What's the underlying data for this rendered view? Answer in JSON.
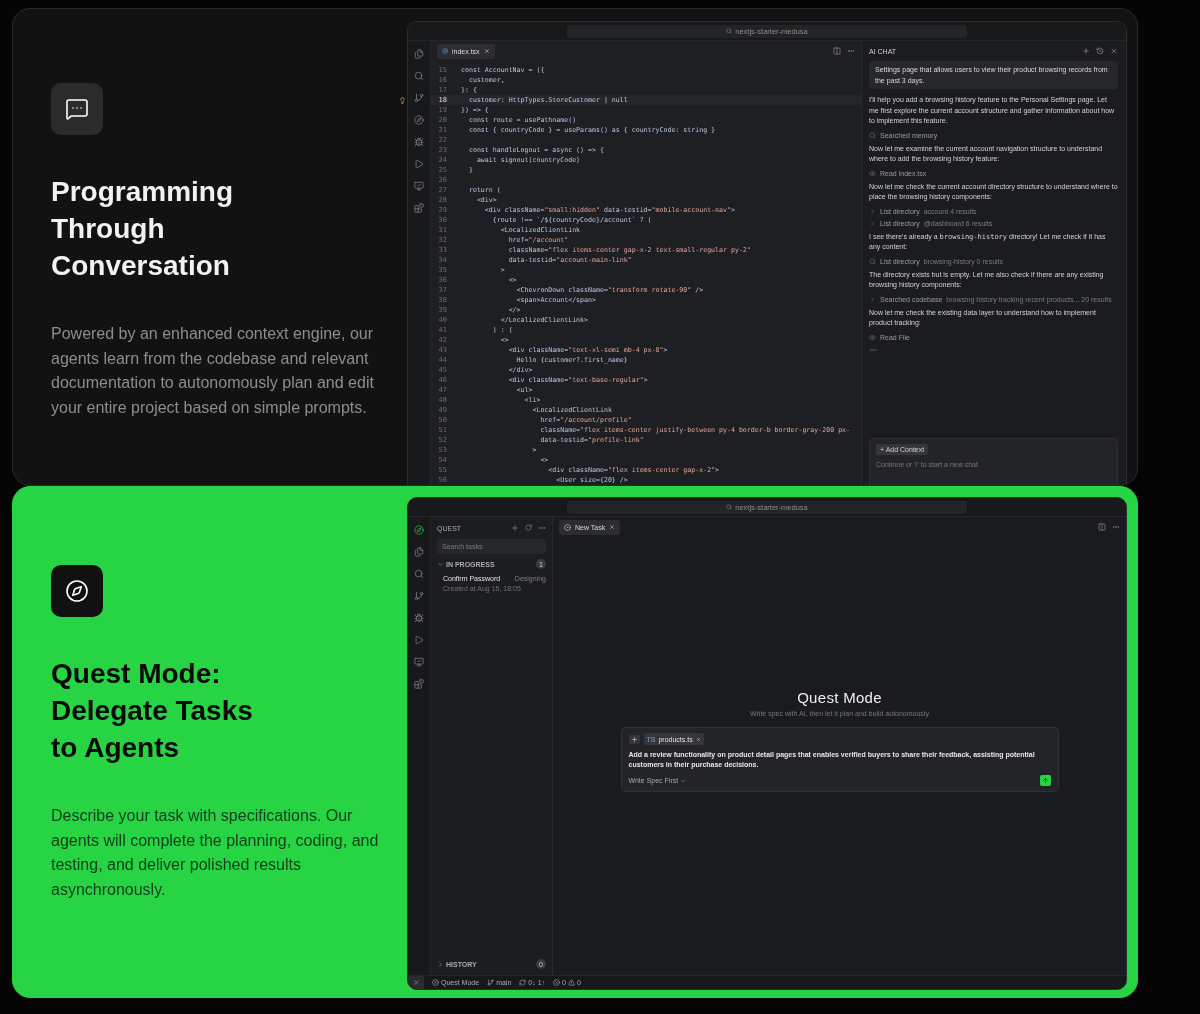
{
  "features": [
    {
      "selected": false,
      "title_lines": [
        "Programming",
        "Through",
        "Conversation"
      ],
      "description": "Powered by an enhanced context engine, our agents learn from the codebase and relevant documentation to autonomously plan and edit your entire project based on simple prompts.",
      "window": {
        "kind": "editor",
        "search": "nextjs-starter-medusa",
        "activity": [
          {
            "kind": "files",
            "selected": false
          },
          {
            "kind": "search",
            "selected": false
          },
          {
            "kind": "branch",
            "selected": false
          },
          {
            "kind": "compass",
            "selected": false
          },
          {
            "kind": "bug",
            "selected": false
          },
          {
            "kind": "play",
            "selected": false
          },
          {
            "kind": "monitor",
            "selected": false
          },
          {
            "kind": "blocks",
            "selected": false
          }
        ],
        "tabs": [
          {
            "label": "index.tsx",
            "selected": true
          }
        ],
        "lines": [
          {
            "n": "15",
            "text": "const AccountNav = ({",
            "current": false
          },
          {
            "n": "16",
            "text": "  customer,",
            "current": false
          },
          {
            "n": "17",
            "text": "}: {",
            "current": false
          },
          {
            "n": "18",
            "text": "  customer: HttpTypes.StoreCustomer | null",
            "current": true
          },
          {
            "n": "19",
            "text": "}) => {",
            "current": false
          },
          {
            "n": "20",
            "text": "  const route = usePathname()",
            "current": false
          },
          {
            "n": "21",
            "text": "  const { countryCode } = useParams() as { countryCode: string }",
            "current": false
          },
          {
            "n": "22",
            "current": false
          },
          {
            "n": "23",
            "text": "  const handleLogout = async () => {",
            "current": false
          },
          {
            "n": "24",
            "text": "    await signout(countryCode)",
            "current": false
          },
          {
            "n": "25",
            "text": "  }",
            "current": false
          },
          {
            "n": "26",
            "current": false
          },
          {
            "n": "27",
            "text": "  return (",
            "current": false
          },
          {
            "n": "28",
            "text": "    <div>",
            "current": false
          },
          {
            "n": "29",
            "text": "      <div className=\"small:hidden\" data-testid=\"mobile-account-nav\">",
            "current": false
          },
          {
            "n": "30",
            "text": "        {route !== `/${countryCode}/account` ? (",
            "current": false
          },
          {
            "n": "31",
            "text": "          <LocalizedClientLink",
            "current": false
          },
          {
            "n": "32",
            "text": "            href=\"/account\"",
            "current": false
          },
          {
            "n": "33",
            "text": "            className=\"flex items-center gap-x-2 text-small-regular py-2\"",
            "current": false
          },
          {
            "n": "34",
            "text": "            data-testid=\"account-main-link\"",
            "current": false
          },
          {
            "n": "35",
            "text": "          >",
            "current": false
          },
          {
            "n": "36",
            "text": "            <>",
            "current": false
          },
          {
            "n": "37",
            "text": "              <ChevronDown className=\"transform rotate-90\" />",
            "current": false
          },
          {
            "n": "38",
            "text": "              <span>Account</span>",
            "current": false
          },
          {
            "n": "39",
            "text": "            </>",
            "current": false
          },
          {
            "n": "40",
            "text": "          </LocalizedClientLink>",
            "current": false
          },
          {
            "n": "41",
            "text": "        ) : (",
            "current": false
          },
          {
            "n": "42",
            "text": "          <>",
            "current": false
          },
          {
            "n": "43",
            "text": "            <div className=\"text-xl-semi mb-4 px-8\">",
            "current": false
          },
          {
            "n": "44",
            "text": "              Hello {customer?.first_name}",
            "current": false
          },
          {
            "n": "45",
            "text": "            </div>",
            "current": false
          },
          {
            "n": "46",
            "text": "            <div className=\"text-base-regular\">",
            "current": false
          },
          {
            "n": "47",
            "text": "              <ul>",
            "current": false
          },
          {
            "n": "48",
            "text": "                <li>",
            "current": false
          },
          {
            "n": "49",
            "text": "                  <LocalizedClientLink",
            "current": false
          },
          {
            "n": "50",
            "text": "                    href=\"/account/profile\"",
            "current": false
          },
          {
            "n": "51",
            "text": "                    className=\"flex items-center justify-between py-4 border-b border-gray-200 px-",
            "current": false
          },
          {
            "n": "52",
            "text": "                    data-testid=\"profile-link\"",
            "current": false
          },
          {
            "n": "53",
            "text": "                  >",
            "current": false
          },
          {
            "n": "54",
            "text": "                    <>",
            "current": false
          },
          {
            "n": "55",
            "text": "                      <div className=\"flex items-center gap-x-2\">",
            "current": false
          },
          {
            "n": "56",
            "text": "                        <User size={20} />",
            "current": false
          }
        ],
        "chat": {
          "title": "AI CHAT",
          "user_message": "Settings page that allows users to view their product browsing records from the past 3 days.",
          "messages": [
            {
              "kind": "text",
              "text": "I'll help you add a browsing history feature to the Personal Settings page. Let me first explore the current account structure and gather information about how to implement this feature."
            },
            {
              "kind": "search_step",
              "label": "Searched memory"
            },
            {
              "kind": "text",
              "text": "Now let me examine the current account navigation structure to understand where to add the browsing history feature:"
            },
            {
              "kind": "read_step",
              "label": "Read index.tsx"
            },
            {
              "kind": "text",
              "text": "Now let me check the current account directory structure to understand where to place the browsing history components:"
            },
            {
              "kind": "list_step",
              "label": "List directory",
              "detail": "account 4 results"
            },
            {
              "kind": "list_step",
              "label": "List directory",
              "detail": "@dashboard 6 results"
            },
            {
              "kind": "code_text",
              "parts": [
                {
                  "text": "I see there's already a ",
                  "code": false
                },
                {
                  "text": "browsing-history",
                  "code": true
                },
                {
                  "text": " directory! Let me check if it has any content:",
                  "code": false
                }
              ]
            },
            {
              "kind": "search_step",
              "label": "List directory",
              "detail": "browsing-history 0 results"
            },
            {
              "kind": "text",
              "text": "The directory exists but is empty. Let me also check if there are any existing browsing history components:"
            },
            {
              "kind": "list_step",
              "label": "Searched codebase",
              "detail": "browsing history tracking recent products... 20 results"
            },
            {
              "kind": "text",
              "text": "Now let me check the existing data layer to understand how to implement product tracking:"
            },
            {
              "kind": "read_step",
              "label": "Read File"
            }
          ],
          "add_context": "+ Add Context",
          "placeholder": "Continue or '/' to start a new chat"
        }
      }
    },
    {
      "selected": true,
      "title_lines": [
        "Quest Mode:",
        "Delegate Tasks",
        "to Agents"
      ],
      "description": "Describe your task with specifications. Our agents will complete the planning, coding, and testing, and deliver polished results asynchronously.",
      "window": {
        "kind": "quest",
        "search": "nextjs-starter-medusa",
        "activity": [
          {
            "kind": "compass",
            "selected": true
          },
          {
            "kind": "files",
            "selected": false
          },
          {
            "kind": "search",
            "selected": false
          },
          {
            "kind": "branch",
            "selected": false
          },
          {
            "kind": "bug",
            "selected": false
          },
          {
            "kind": "play",
            "selected": false
          },
          {
            "kind": "monitor",
            "selected": false
          },
          {
            "kind": "blocks",
            "selected": false
          }
        ],
        "sidebar": {
          "title": "QUEST",
          "search_placeholder": "Search tasks",
          "sections": [
            {
              "label": "IN PROGRESS",
              "count": "1",
              "expanded": true,
              "tasks": [
                {
                  "title": "Confirm Password",
                  "status": "Designing",
                  "created": "Created at Aug 15, 18:05"
                }
              ]
            },
            {
              "label": "HISTORY",
              "count": "0",
              "expanded": false
            }
          ]
        },
        "tabs": [
          {
            "label": "New Task",
            "selected": true
          }
        ],
        "heading": "Quest Mode",
        "subheading": "Write spec with AI, then let it plan and build autonomously",
        "composer": {
          "attachments": [
            {
              "badge": "TS",
              "name": "products.ts"
            }
          ],
          "value": "Add a review functionality on product detail pages that enables verified buyers to share their feedback, assisting potential customers in their purchase decisions.",
          "mode": "Write Spec First"
        },
        "status_bar": {
          "mode": "Quest Mode",
          "branch": "main",
          "sync": "0↓ 1↑",
          "errors": "0",
          "warnings": "0"
        }
      }
    }
  ]
}
